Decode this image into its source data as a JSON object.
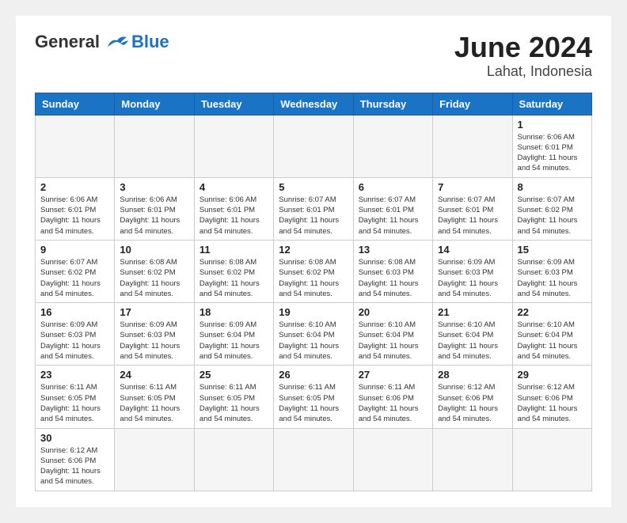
{
  "header": {
    "logo": {
      "general": "General",
      "blue": "Blue"
    },
    "title": "June 2024",
    "location": "Lahat, Indonesia"
  },
  "weekdays": [
    "Sunday",
    "Monday",
    "Tuesday",
    "Wednesday",
    "Thursday",
    "Friday",
    "Saturday"
  ],
  "weeks": [
    [
      {
        "day": "",
        "empty": true
      },
      {
        "day": "",
        "empty": true
      },
      {
        "day": "",
        "empty": true
      },
      {
        "day": "",
        "empty": true
      },
      {
        "day": "",
        "empty": true
      },
      {
        "day": "",
        "empty": true
      },
      {
        "day": "1",
        "sunrise": "Sunrise: 6:06 AM",
        "sunset": "Sunset: 6:01 PM",
        "daylight": "Daylight: 11 hours and 54 minutes."
      }
    ],
    [
      {
        "day": "2",
        "sunrise": "Sunrise: 6:06 AM",
        "sunset": "Sunset: 6:01 PM",
        "daylight": "Daylight: 11 hours and 54 minutes."
      },
      {
        "day": "3",
        "sunrise": "Sunrise: 6:06 AM",
        "sunset": "Sunset: 6:01 PM",
        "daylight": "Daylight: 11 hours and 54 minutes."
      },
      {
        "day": "4",
        "sunrise": "Sunrise: 6:06 AM",
        "sunset": "Sunset: 6:01 PM",
        "daylight": "Daylight: 11 hours and 54 minutes."
      },
      {
        "day": "5",
        "sunrise": "Sunrise: 6:07 AM",
        "sunset": "Sunset: 6:01 PM",
        "daylight": "Daylight: 11 hours and 54 minutes."
      },
      {
        "day": "6",
        "sunrise": "Sunrise: 6:07 AM",
        "sunset": "Sunset: 6:01 PM",
        "daylight": "Daylight: 11 hours and 54 minutes."
      },
      {
        "day": "7",
        "sunrise": "Sunrise: 6:07 AM",
        "sunset": "Sunset: 6:01 PM",
        "daylight": "Daylight: 11 hours and 54 minutes."
      },
      {
        "day": "8",
        "sunrise": "Sunrise: 6:07 AM",
        "sunset": "Sunset: 6:02 PM",
        "daylight": "Daylight: 11 hours and 54 minutes."
      }
    ],
    [
      {
        "day": "9",
        "sunrise": "Sunrise: 6:07 AM",
        "sunset": "Sunset: 6:02 PM",
        "daylight": "Daylight: 11 hours and 54 minutes."
      },
      {
        "day": "10",
        "sunrise": "Sunrise: 6:08 AM",
        "sunset": "Sunset: 6:02 PM",
        "daylight": "Daylight: 11 hours and 54 minutes."
      },
      {
        "day": "11",
        "sunrise": "Sunrise: 6:08 AM",
        "sunset": "Sunset: 6:02 PM",
        "daylight": "Daylight: 11 hours and 54 minutes."
      },
      {
        "day": "12",
        "sunrise": "Sunrise: 6:08 AM",
        "sunset": "Sunset: 6:02 PM",
        "daylight": "Daylight: 11 hours and 54 minutes."
      },
      {
        "day": "13",
        "sunrise": "Sunrise: 6:08 AM",
        "sunset": "Sunset: 6:03 PM",
        "daylight": "Daylight: 11 hours and 54 minutes."
      },
      {
        "day": "14",
        "sunrise": "Sunrise: 6:09 AM",
        "sunset": "Sunset: 6:03 PM",
        "daylight": "Daylight: 11 hours and 54 minutes."
      },
      {
        "day": "15",
        "sunrise": "Sunrise: 6:09 AM",
        "sunset": "Sunset: 6:03 PM",
        "daylight": "Daylight: 11 hours and 54 minutes."
      }
    ],
    [
      {
        "day": "16",
        "sunrise": "Sunrise: 6:09 AM",
        "sunset": "Sunset: 6:03 PM",
        "daylight": "Daylight: 11 hours and 54 minutes."
      },
      {
        "day": "17",
        "sunrise": "Sunrise: 6:09 AM",
        "sunset": "Sunset: 6:03 PM",
        "daylight": "Daylight: 11 hours and 54 minutes."
      },
      {
        "day": "18",
        "sunrise": "Sunrise: 6:09 AM",
        "sunset": "Sunset: 6:04 PM",
        "daylight": "Daylight: 11 hours and 54 minutes."
      },
      {
        "day": "19",
        "sunrise": "Sunrise: 6:10 AM",
        "sunset": "Sunset: 6:04 PM",
        "daylight": "Daylight: 11 hours and 54 minutes."
      },
      {
        "day": "20",
        "sunrise": "Sunrise: 6:10 AM",
        "sunset": "Sunset: 6:04 PM",
        "daylight": "Daylight: 11 hours and 54 minutes."
      },
      {
        "day": "21",
        "sunrise": "Sunrise: 6:10 AM",
        "sunset": "Sunset: 6:04 PM",
        "daylight": "Daylight: 11 hours and 54 minutes."
      },
      {
        "day": "22",
        "sunrise": "Sunrise: 6:10 AM",
        "sunset": "Sunset: 6:04 PM",
        "daylight": "Daylight: 11 hours and 54 minutes."
      }
    ],
    [
      {
        "day": "23",
        "sunrise": "Sunrise: 6:11 AM",
        "sunset": "Sunset: 6:05 PM",
        "daylight": "Daylight: 11 hours and 54 minutes."
      },
      {
        "day": "24",
        "sunrise": "Sunrise: 6:11 AM",
        "sunset": "Sunset: 6:05 PM",
        "daylight": "Daylight: 11 hours and 54 minutes."
      },
      {
        "day": "25",
        "sunrise": "Sunrise: 6:11 AM",
        "sunset": "Sunset: 6:05 PM",
        "daylight": "Daylight: 11 hours and 54 minutes."
      },
      {
        "day": "26",
        "sunrise": "Sunrise: 6:11 AM",
        "sunset": "Sunset: 6:05 PM",
        "daylight": "Daylight: 11 hours and 54 minutes."
      },
      {
        "day": "27",
        "sunrise": "Sunrise: 6:11 AM",
        "sunset": "Sunset: 6:06 PM",
        "daylight": "Daylight: 11 hours and 54 minutes."
      },
      {
        "day": "28",
        "sunrise": "Sunrise: 6:12 AM",
        "sunset": "Sunset: 6:06 PM",
        "daylight": "Daylight: 11 hours and 54 minutes."
      },
      {
        "day": "29",
        "sunrise": "Sunrise: 6:12 AM",
        "sunset": "Sunset: 6:06 PM",
        "daylight": "Daylight: 11 hours and 54 minutes."
      }
    ],
    [
      {
        "day": "30",
        "sunrise": "Sunrise: 6:12 AM",
        "sunset": "Sunset: 6:06 PM",
        "daylight": "Daylight: 11 hours and 54 minutes."
      },
      {
        "day": "",
        "empty": true
      },
      {
        "day": "",
        "empty": true
      },
      {
        "day": "",
        "empty": true
      },
      {
        "day": "",
        "empty": true
      },
      {
        "day": "",
        "empty": true
      },
      {
        "day": "",
        "empty": true
      }
    ]
  ]
}
